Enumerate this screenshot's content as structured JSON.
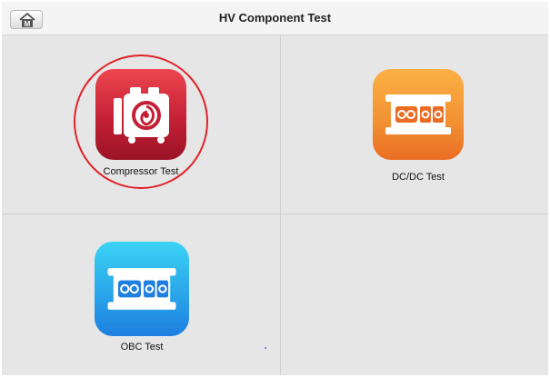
{
  "header": {
    "title": "HV Component Test",
    "home_button_glyph": "M"
  },
  "tiles": [
    {
      "label": "Compressor Test",
      "icon": "compressor-icon",
      "color": "#c42035",
      "highlighted": true
    },
    {
      "label": "DC/DC Test",
      "icon": "dcdc-converter-icon",
      "color": "#f39334",
      "highlighted": false
    },
    {
      "label": "OBC Test",
      "icon": "obc-charger-icon",
      "color": "#2aa6ea",
      "highlighted": false
    }
  ],
  "colors": {
    "highlight_ring": "#e2232a",
    "background": "#e6e6e6"
  }
}
